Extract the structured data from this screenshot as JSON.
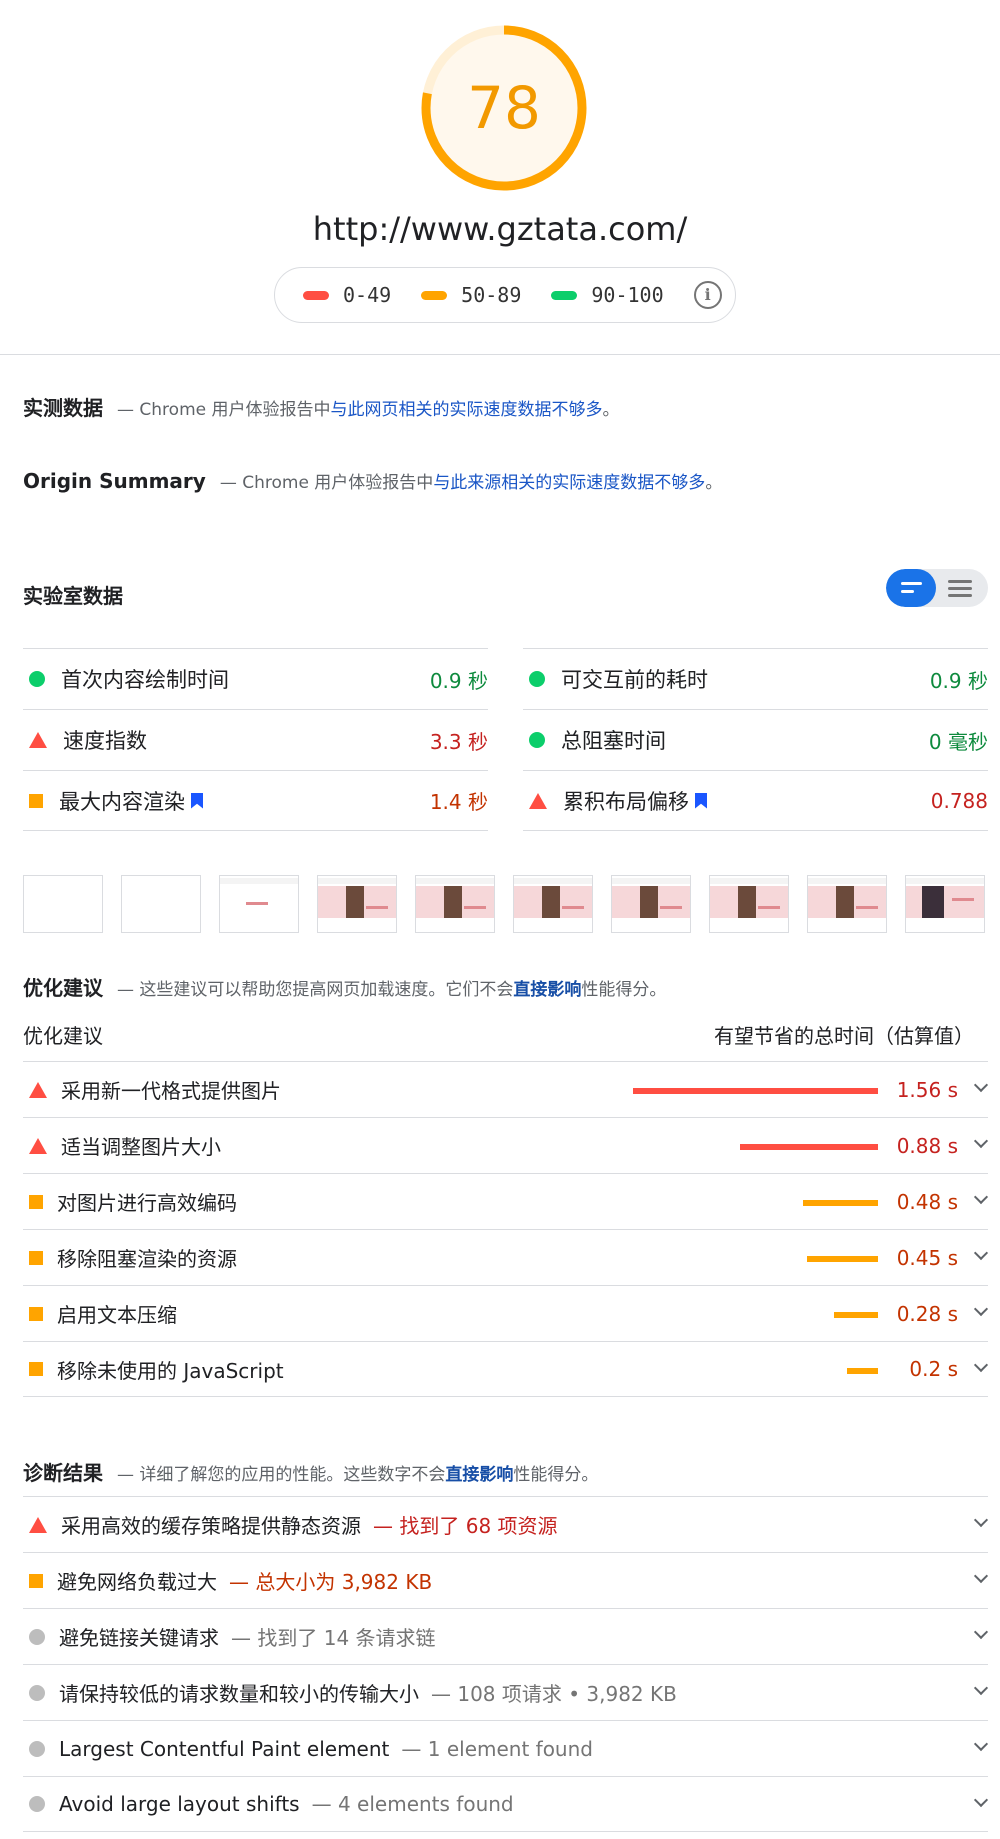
{
  "score": "78",
  "url": "http://www.gztata.com/",
  "legend": [
    {
      "range": "0-49",
      "color": "#ff4e42"
    },
    {
      "range": "50-89",
      "color": "#ffa400"
    },
    {
      "range": "90-100",
      "color": "#0cce6b"
    }
  ],
  "field_data": {
    "title": "实测数据",
    "desc_prefix": "— Chrome 用户体验报告中",
    "desc_link": "与此网页相关的实际速度数据不够多",
    "desc_suffix": "。"
  },
  "origin_summary": {
    "title": "Origin Summary",
    "desc_prefix": "— Chrome 用户体验报告中",
    "desc_link": "与此来源相关的实际速度数据不够多",
    "desc_suffix": "。"
  },
  "lab_data": {
    "title": "实验室数据",
    "metrics_left": [
      {
        "label": "首次内容绘制时间",
        "value": "0.9 秒",
        "status": "pass",
        "color": "#0d8a3d"
      },
      {
        "label": "速度指数",
        "value": "3.3 秒",
        "status": "fail",
        "color": "#c5221f"
      },
      {
        "label": "最大内容渲染",
        "value": "1.4 秒",
        "status": "avg",
        "color": "#c33300"
      }
    ],
    "metrics_right": [
      {
        "label": "可交互前的耗时",
        "value": "0.9 秒",
        "status": "pass",
        "color": "#0d8a3d"
      },
      {
        "label": "总阻塞时间",
        "value": "0 毫秒",
        "status": "pass",
        "color": "#0d8a3d"
      },
      {
        "label": "累积布局偏移",
        "value": "0.788",
        "status": "fail",
        "color": "#c5221f"
      }
    ]
  },
  "opportunities": {
    "title": "优化建议",
    "desc_prefix": "— 这些建议可以帮助您提高网页加载速度。它们不会",
    "desc_link": "直接影响",
    "desc_suffix": "性能得分。",
    "col_left": "优化建议",
    "col_right": "有望节省的总时间（估算值）",
    "items": [
      {
        "label": "采用新一代格式提供图片",
        "value": "1.56 s",
        "savings": 1.56,
        "status": "fail"
      },
      {
        "label": "适当调整图片大小",
        "value": "0.88 s",
        "savings": 0.88,
        "status": "fail"
      },
      {
        "label": "对图片进行高效编码",
        "value": "0.48 s",
        "savings": 0.48,
        "status": "avg"
      },
      {
        "label": "移除阻塞渲染的资源",
        "value": "0.45 s",
        "savings": 0.45,
        "status": "avg"
      },
      {
        "label": "启用文本压缩",
        "value": "0.28 s",
        "savings": 0.28,
        "status": "avg"
      },
      {
        "label": "移除未使用的 JavaScript",
        "value": "0.2 s",
        "savings": 0.2,
        "status": "avg"
      }
    ]
  },
  "diagnostics": {
    "title": "诊断结果",
    "desc_prefix": "— 详细了解您的应用的性能。这些数字不会",
    "desc_link": "直接影响",
    "desc_suffix": "性能得分。",
    "items": [
      {
        "label": "采用高效的缓存策略提供静态资源",
        "desc": "— 找到了 68 项资源",
        "status": "fail"
      },
      {
        "label": "避免网络负载过大",
        "desc": "— 总大小为 3,982 KB",
        "status": "avg"
      },
      {
        "label": "避免链接关键请求",
        "desc": "— 找到了 14 条请求链",
        "status": "info"
      },
      {
        "label": "请保持较低的请求数量和较小的传输大小",
        "desc": "— 108 项请求 • 3,982 KB",
        "status": "info"
      },
      {
        "label": "Largest Contentful Paint element",
        "desc": "— 1 element found",
        "status": "info"
      },
      {
        "label": "Avoid large layout shifts",
        "desc": "— 4 elements found",
        "status": "info"
      }
    ]
  },
  "colors": {
    "fail": "#c5221f",
    "avg": "#c33300",
    "info": "#757575",
    "gauge": "#ffa400"
  }
}
